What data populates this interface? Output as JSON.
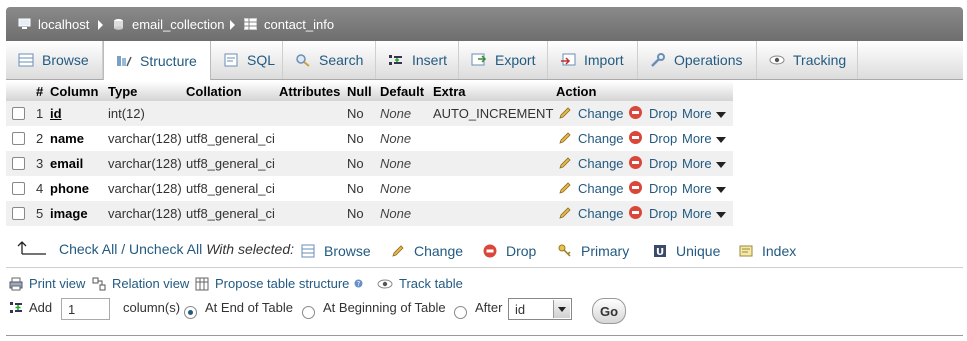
{
  "breadcrumb": {
    "server": "localhost",
    "database": "email_collection",
    "table": "contact_info"
  },
  "tabs": [
    {
      "label": "Browse",
      "icon": "browse-icon"
    },
    {
      "label": "Structure",
      "icon": "structure-icon",
      "active": true
    },
    {
      "label": "SQL",
      "icon": "sql-icon"
    },
    {
      "label": "Search",
      "icon": "search-icon"
    },
    {
      "label": "Insert",
      "icon": "insert-icon"
    },
    {
      "label": "Export",
      "icon": "export-icon"
    },
    {
      "label": "Import",
      "icon": "import-icon"
    },
    {
      "label": "Operations",
      "icon": "operations-icon"
    },
    {
      "label": "Tracking",
      "icon": "tracking-icon"
    }
  ],
  "table": {
    "headers": [
      "#",
      "Column",
      "Type",
      "Collation",
      "Attributes",
      "Null",
      "Default",
      "Extra",
      "Action"
    ],
    "rows": [
      {
        "num": "1",
        "column": "id",
        "type": "int(12)",
        "collation": "",
        "attributes": "",
        "null": "No",
        "default": "None",
        "extra": "AUTO_INCREMENT"
      },
      {
        "num": "2",
        "column": "name",
        "type": "varchar(128)",
        "collation": "utf8_general_ci",
        "attributes": "",
        "null": "No",
        "default": "None",
        "extra": ""
      },
      {
        "num": "3",
        "column": "email",
        "type": "varchar(128)",
        "collation": "utf8_general_ci",
        "attributes": "",
        "null": "No",
        "default": "None",
        "extra": ""
      },
      {
        "num": "4",
        "column": "phone",
        "type": "varchar(128)",
        "collation": "utf8_general_ci",
        "attributes": "",
        "null": "No",
        "default": "None",
        "extra": ""
      },
      {
        "num": "5",
        "column": "image",
        "type": "varchar(128)",
        "collation": "utf8_general_ci",
        "attributes": "",
        "null": "No",
        "default": "None",
        "extra": ""
      }
    ],
    "action_change": "Change",
    "action_drop": "Drop",
    "action_more": "More"
  },
  "with_selected": {
    "check_all": "Check All",
    "separator": " / ",
    "uncheck_all": "Uncheck All",
    "label": "With selected:",
    "browse": "Browse",
    "change": "Change",
    "drop": "Drop",
    "primary": "Primary",
    "unique": "Unique",
    "index": "Index"
  },
  "bottom_links": {
    "print_view": "Print view",
    "relation_view": "Relation view",
    "propose": "Propose table structure",
    "track_table": "Track table"
  },
  "add_columns": {
    "add_label": "Add",
    "count": "1",
    "columns_label": "column(s)",
    "at_end": "At End of Table",
    "at_beginning": "At Beginning of Table",
    "after": "After",
    "after_value": "id",
    "go": "Go"
  }
}
